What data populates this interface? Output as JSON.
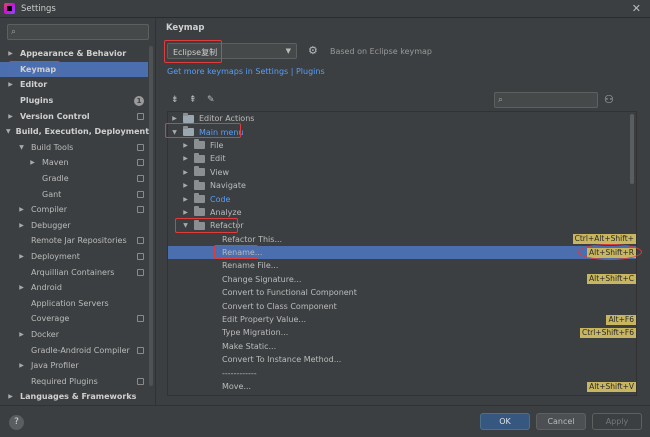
{
  "window": {
    "title": "Settings",
    "close": "✕"
  },
  "sidebar": {
    "search_placeholder": "",
    "items": [
      {
        "label": "Appearance & Behavior",
        "level": 0,
        "arrow": "▶",
        "bold": true
      },
      {
        "label": "Keymap",
        "level": 0,
        "arrow": "",
        "bold": true,
        "selected": true
      },
      {
        "label": "Editor",
        "level": 0,
        "arrow": "▶",
        "bold": true
      },
      {
        "label": "Plugins",
        "level": 0,
        "arrow": "",
        "bold": true,
        "badge": "1"
      },
      {
        "label": "Version Control",
        "level": 0,
        "arrow": "▶",
        "bold": true,
        "page": true
      },
      {
        "label": "Build, Execution, Deployment",
        "level": 0,
        "arrow": "▼",
        "bold": true
      },
      {
        "label": "Build Tools",
        "level": 1,
        "arrow": "▼",
        "page": true
      },
      {
        "label": "Maven",
        "level": 2,
        "arrow": "▶",
        "page": true
      },
      {
        "label": "Gradle",
        "level": 2,
        "arrow": "",
        "page": true
      },
      {
        "label": "Gant",
        "level": 2,
        "arrow": "",
        "page": true
      },
      {
        "label": "Compiler",
        "level": 1,
        "arrow": "▶",
        "page": true
      },
      {
        "label": "Debugger",
        "level": 1,
        "arrow": "▶",
        "page": false
      },
      {
        "label": "Remote Jar Repositories",
        "level": 1,
        "arrow": "",
        "page": true
      },
      {
        "label": "Deployment",
        "level": 1,
        "arrow": "▶",
        "page": true
      },
      {
        "label": "Arquillian Containers",
        "level": 1,
        "arrow": "",
        "page": true
      },
      {
        "label": "Android",
        "level": 1,
        "arrow": "▶",
        "page": false
      },
      {
        "label": "Application Servers",
        "level": 1,
        "arrow": "",
        "page": false
      },
      {
        "label": "Coverage",
        "level": 1,
        "arrow": "",
        "page": true
      },
      {
        "label": "Docker",
        "level": 1,
        "arrow": "▶",
        "page": false
      },
      {
        "label": "Gradle-Android Compiler",
        "level": 1,
        "arrow": "",
        "page": true
      },
      {
        "label": "Java Profiler",
        "level": 1,
        "arrow": "▶",
        "page": false
      },
      {
        "label": "Required Plugins",
        "level": 1,
        "arrow": "",
        "page": true
      },
      {
        "label": "Languages & Frameworks",
        "level": 0,
        "arrow": "▶",
        "bold": true
      }
    ]
  },
  "main": {
    "title": "Keymap",
    "keymap_value": "Eclipse复制",
    "based_on": "Based on Eclipse keymap",
    "more_link": "Get more keymaps in Settings | Plugins",
    "actions": [
      {
        "label": "Editor Actions",
        "level": 0,
        "arrow": "▶",
        "folder": "special"
      },
      {
        "label": "Main menu",
        "level": 0,
        "arrow": "▼",
        "folder": "special",
        "blue": true
      },
      {
        "label": "File",
        "level": 1,
        "arrow": "▶",
        "folder": "normal"
      },
      {
        "label": "Edit",
        "level": 1,
        "arrow": "▶",
        "folder": "normal"
      },
      {
        "label": "View",
        "level": 1,
        "arrow": "▶",
        "folder": "normal"
      },
      {
        "label": "Navigate",
        "level": 1,
        "arrow": "▶",
        "folder": "normal"
      },
      {
        "label": "Code",
        "level": 1,
        "arrow": "▶",
        "folder": "normal",
        "blue": true
      },
      {
        "label": "Analyze",
        "level": 1,
        "arrow": "▶",
        "folder": "normal"
      },
      {
        "label": "Refactor",
        "level": 1,
        "arrow": "▼",
        "folder": "normal"
      },
      {
        "label": "Refactor This...",
        "level": 2,
        "shortcut": "Ctrl+Alt+Shift+"
      },
      {
        "label": "Rename...",
        "level": 2,
        "shortcut": "Alt+Shift+R",
        "selected": true
      },
      {
        "label": "Rename File...",
        "level": 2
      },
      {
        "label": "Change Signature...",
        "level": 2,
        "shortcut": "Alt+Shift+C"
      },
      {
        "label": "Convert to Functional Component",
        "level": 2
      },
      {
        "label": "Convert to Class Component",
        "level": 2
      },
      {
        "label": "Edit Property Value...",
        "level": 2,
        "shortcut": "Alt+F6"
      },
      {
        "label": "Type Migration...",
        "level": 2,
        "shortcut": "Ctrl+Shift+F6"
      },
      {
        "label": "Make Static...",
        "level": 2
      },
      {
        "label": "Convert To Instance Method...",
        "level": 2
      },
      {
        "label": "------------",
        "level": 2
      },
      {
        "label": "Move...",
        "level": 2,
        "shortcut": "Alt+Shift+V"
      }
    ]
  },
  "footer": {
    "help": "?",
    "ok": "OK",
    "cancel": "Cancel",
    "apply": "Apply"
  }
}
